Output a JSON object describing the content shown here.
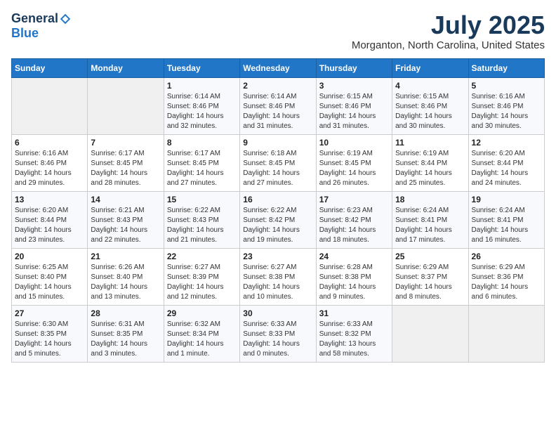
{
  "header": {
    "logo_general": "General",
    "logo_blue": "Blue",
    "month_title": "July 2025",
    "location": "Morganton, North Carolina, United States"
  },
  "weekdays": [
    "Sunday",
    "Monday",
    "Tuesday",
    "Wednesday",
    "Thursday",
    "Friday",
    "Saturday"
  ],
  "weeks": [
    [
      {
        "day": "",
        "info": ""
      },
      {
        "day": "",
        "info": ""
      },
      {
        "day": "1",
        "info": "Sunrise: 6:14 AM\nSunset: 8:46 PM\nDaylight: 14 hours\nand 32 minutes."
      },
      {
        "day": "2",
        "info": "Sunrise: 6:14 AM\nSunset: 8:46 PM\nDaylight: 14 hours\nand 31 minutes."
      },
      {
        "day": "3",
        "info": "Sunrise: 6:15 AM\nSunset: 8:46 PM\nDaylight: 14 hours\nand 31 minutes."
      },
      {
        "day": "4",
        "info": "Sunrise: 6:15 AM\nSunset: 8:46 PM\nDaylight: 14 hours\nand 30 minutes."
      },
      {
        "day": "5",
        "info": "Sunrise: 6:16 AM\nSunset: 8:46 PM\nDaylight: 14 hours\nand 30 minutes."
      }
    ],
    [
      {
        "day": "6",
        "info": "Sunrise: 6:16 AM\nSunset: 8:46 PM\nDaylight: 14 hours\nand 29 minutes."
      },
      {
        "day": "7",
        "info": "Sunrise: 6:17 AM\nSunset: 8:45 PM\nDaylight: 14 hours\nand 28 minutes."
      },
      {
        "day": "8",
        "info": "Sunrise: 6:17 AM\nSunset: 8:45 PM\nDaylight: 14 hours\nand 27 minutes."
      },
      {
        "day": "9",
        "info": "Sunrise: 6:18 AM\nSunset: 8:45 PM\nDaylight: 14 hours\nand 27 minutes."
      },
      {
        "day": "10",
        "info": "Sunrise: 6:19 AM\nSunset: 8:45 PM\nDaylight: 14 hours\nand 26 minutes."
      },
      {
        "day": "11",
        "info": "Sunrise: 6:19 AM\nSunset: 8:44 PM\nDaylight: 14 hours\nand 25 minutes."
      },
      {
        "day": "12",
        "info": "Sunrise: 6:20 AM\nSunset: 8:44 PM\nDaylight: 14 hours\nand 24 minutes."
      }
    ],
    [
      {
        "day": "13",
        "info": "Sunrise: 6:20 AM\nSunset: 8:44 PM\nDaylight: 14 hours\nand 23 minutes."
      },
      {
        "day": "14",
        "info": "Sunrise: 6:21 AM\nSunset: 8:43 PM\nDaylight: 14 hours\nand 22 minutes."
      },
      {
        "day": "15",
        "info": "Sunrise: 6:22 AM\nSunset: 8:43 PM\nDaylight: 14 hours\nand 21 minutes."
      },
      {
        "day": "16",
        "info": "Sunrise: 6:22 AM\nSunset: 8:42 PM\nDaylight: 14 hours\nand 19 minutes."
      },
      {
        "day": "17",
        "info": "Sunrise: 6:23 AM\nSunset: 8:42 PM\nDaylight: 14 hours\nand 18 minutes."
      },
      {
        "day": "18",
        "info": "Sunrise: 6:24 AM\nSunset: 8:41 PM\nDaylight: 14 hours\nand 17 minutes."
      },
      {
        "day": "19",
        "info": "Sunrise: 6:24 AM\nSunset: 8:41 PM\nDaylight: 14 hours\nand 16 minutes."
      }
    ],
    [
      {
        "day": "20",
        "info": "Sunrise: 6:25 AM\nSunset: 8:40 PM\nDaylight: 14 hours\nand 15 minutes."
      },
      {
        "day": "21",
        "info": "Sunrise: 6:26 AM\nSunset: 8:40 PM\nDaylight: 14 hours\nand 13 minutes."
      },
      {
        "day": "22",
        "info": "Sunrise: 6:27 AM\nSunset: 8:39 PM\nDaylight: 14 hours\nand 12 minutes."
      },
      {
        "day": "23",
        "info": "Sunrise: 6:27 AM\nSunset: 8:38 PM\nDaylight: 14 hours\nand 10 minutes."
      },
      {
        "day": "24",
        "info": "Sunrise: 6:28 AM\nSunset: 8:38 PM\nDaylight: 14 hours\nand 9 minutes."
      },
      {
        "day": "25",
        "info": "Sunrise: 6:29 AM\nSunset: 8:37 PM\nDaylight: 14 hours\nand 8 minutes."
      },
      {
        "day": "26",
        "info": "Sunrise: 6:29 AM\nSunset: 8:36 PM\nDaylight: 14 hours\nand 6 minutes."
      }
    ],
    [
      {
        "day": "27",
        "info": "Sunrise: 6:30 AM\nSunset: 8:35 PM\nDaylight: 14 hours\nand 5 minutes."
      },
      {
        "day": "28",
        "info": "Sunrise: 6:31 AM\nSunset: 8:35 PM\nDaylight: 14 hours\nand 3 minutes."
      },
      {
        "day": "29",
        "info": "Sunrise: 6:32 AM\nSunset: 8:34 PM\nDaylight: 14 hours\nand 1 minute."
      },
      {
        "day": "30",
        "info": "Sunrise: 6:33 AM\nSunset: 8:33 PM\nDaylight: 14 hours\nand 0 minutes."
      },
      {
        "day": "31",
        "info": "Sunrise: 6:33 AM\nSunset: 8:32 PM\nDaylight: 13 hours\nand 58 minutes."
      },
      {
        "day": "",
        "info": ""
      },
      {
        "day": "",
        "info": ""
      }
    ]
  ]
}
